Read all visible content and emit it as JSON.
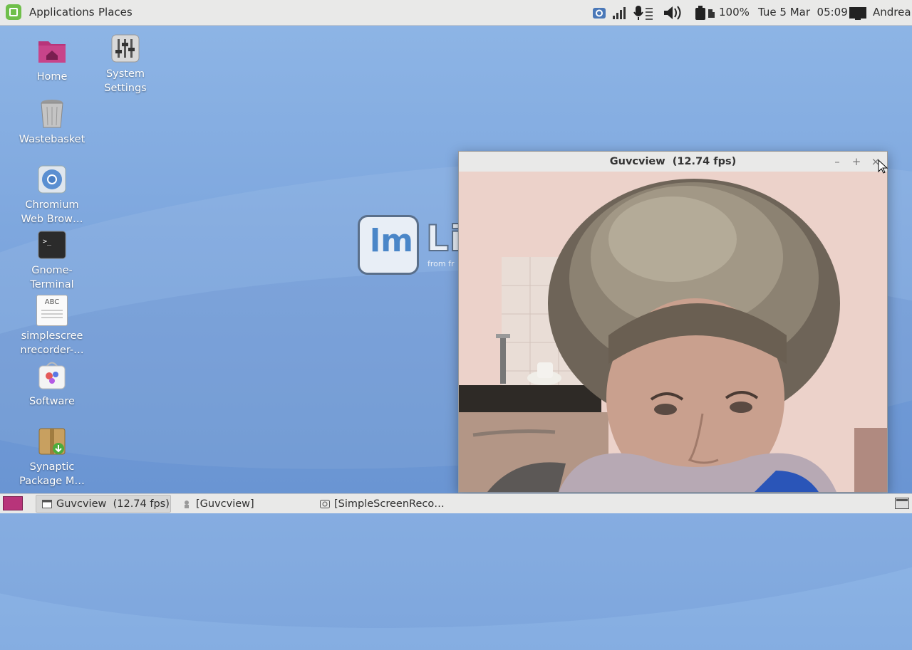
{
  "top_panel": {
    "menu_applications": "Applications",
    "menu_places": "Places",
    "battery": "100%",
    "clock": "Tue 5 Mar  05:09",
    "user": "Andrea"
  },
  "desktop": {
    "icons": [
      {
        "label": "Home"
      },
      {
        "label": "System\nSettings"
      },
      {
        "label": "Wastebasket"
      },
      {
        "label": "Chromium\nWeb Brow…"
      },
      {
        "label": "Gnome-\nTerminal"
      },
      {
        "label": "simplescree\nnrecorder-…"
      },
      {
        "label": "Software"
      },
      {
        "label": "Synaptic\nPackage M…"
      }
    ],
    "doc_icon_text": "ABC",
    "watermark_text": "Lin",
    "watermark_sub": "from fr"
  },
  "window": {
    "title": "Guvcview  (12.74 fps)",
    "minimize_glyph": "–",
    "maximize_glyph": "+",
    "close_glyph": "×"
  },
  "taskbar": {
    "tasks": [
      {
        "label": "Guvcview  (12.74 fps)",
        "active": true
      },
      {
        "label": "[Guvcview]",
        "active": false
      },
      {
        "label": "[SimpleScreenReco…",
        "active": false
      }
    ]
  },
  "colors": {
    "panel": "#e9e9e8",
    "desktop": "#7ea7de",
    "mint_green": "#6fbf4a"
  }
}
